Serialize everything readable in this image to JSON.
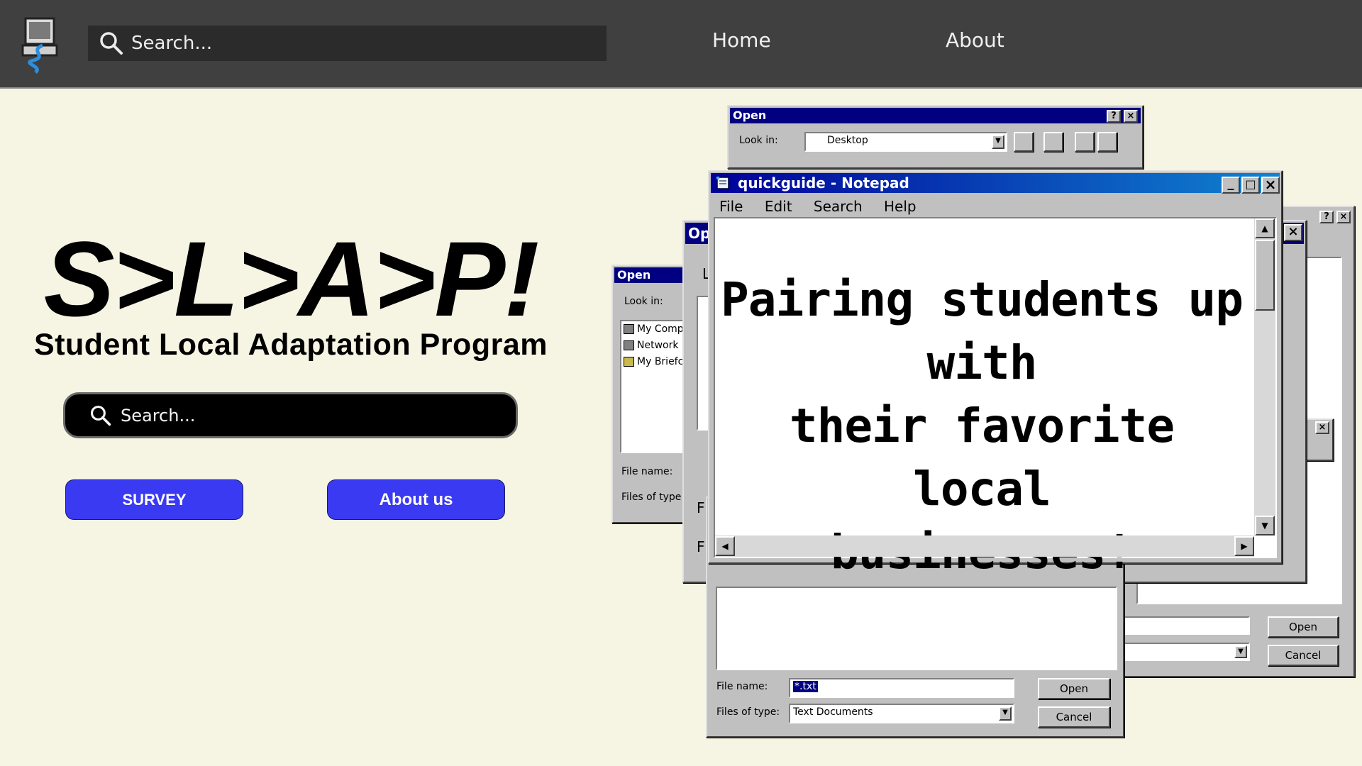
{
  "nav": {
    "search_placeholder": "Search...",
    "links": [
      "Home",
      "About"
    ]
  },
  "hero": {
    "title": "S>L>A>P!",
    "subtitle": "Student Local Adaptation Program",
    "search_placeholder": "Search...",
    "survey_button": "SURVEY",
    "about_button": "About us"
  },
  "colors": {
    "nav_bg": "#404040",
    "page_bg": "#f6f5e4",
    "button": "#3a3af2",
    "win_title": "#000080"
  },
  "dialog_top": {
    "title": "Open",
    "look_in_label": "Look in:",
    "look_in_value": "Desktop"
  },
  "dialog_left": {
    "title": "Open",
    "look_in_label": "Look in:",
    "items": [
      "My Comp",
      "Network",
      "My Briefc"
    ],
    "file_name_label": "File name:",
    "files_of_type_label": "Files of type:"
  },
  "dialog_mid": {
    "title_fragment": "Op",
    "label_fragment_1": "L",
    "label_fragment_2": "F",
    "label_fragment_3": "F"
  },
  "dialog_front": {
    "file_name_label": "File name:",
    "file_name_value": "*.txt",
    "files_of_type_label": "Files of type:",
    "files_of_type_value": "Text Documents",
    "open_button": "Open",
    "cancel_button": "Cancel"
  },
  "dialog_right": {
    "open_button": "Open",
    "cancel_button": "Cancel"
  },
  "notepad": {
    "title": "quickguide - Notepad",
    "menu": [
      "File",
      "Edit",
      "Search",
      "Help"
    ],
    "body_lines": [
      "Pairing students up with",
      "their favorite local",
      "businesses!"
    ]
  }
}
